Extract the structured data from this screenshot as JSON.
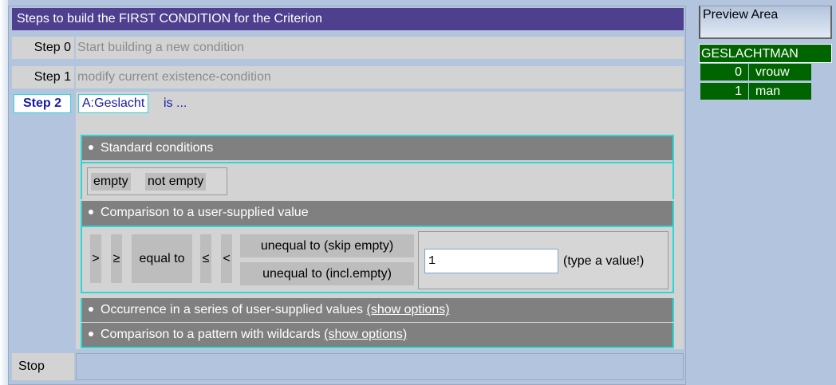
{
  "main": {
    "title": "Steps to build the FIRST CONDITION for the Criterion",
    "steps": [
      {
        "label": "Step 0",
        "text": "Start building a new condition"
      },
      {
        "label": "Step 1",
        "text": "modify current existence-condition"
      },
      {
        "label": "Step 2",
        "attribute": "A:Geslacht",
        "suffix": "is ..."
      }
    ],
    "stop_label": "Stop"
  },
  "standard": {
    "header": "Standard conditions",
    "buttons": [
      "empty",
      "not empty"
    ]
  },
  "comparison": {
    "header": "Comparison to a user-supplied value",
    "ops": [
      ">",
      "≥",
      "equal to",
      "≤",
      "<"
    ],
    "unequal_skip": "unequal to (skip empty)",
    "unequal_incl": "unequal to (incl.empty)",
    "input_value": "1",
    "hint": "(type a value!)"
  },
  "occurrence": {
    "header": "Occurrence in a series of user-supplied values",
    "link": "(show options)"
  },
  "pattern": {
    "header": "Comparison to a pattern with wildcards",
    "link": "(show options)"
  },
  "preview": {
    "title": "Preview Area",
    "table_header": "GESLACHTMAN",
    "rows": [
      {
        "num": "0",
        "val": "vrouw"
      },
      {
        "num": "1",
        "val": "man"
      }
    ]
  },
  "colors": {
    "title_bar": "#4e3f8f",
    "cyan_border": "#2fd6d6",
    "section_header": "#808080",
    "preview_green": "#006400",
    "background": "#b3c5de"
  }
}
